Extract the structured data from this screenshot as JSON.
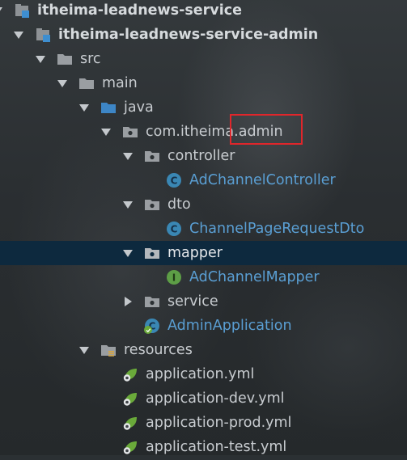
{
  "project_tree": {
    "nodes": [
      {
        "key": "r0",
        "label": "itheima-leadnews-service",
        "icon": "module-icon",
        "expand": "down",
        "style": "bold"
      },
      {
        "key": "r1",
        "label": "itheima-leadnews-service-admin",
        "icon": "module-icon",
        "expand": "down",
        "style": "bold"
      },
      {
        "key": "r2",
        "label": "src",
        "icon": "folder-icon",
        "expand": "down",
        "style": ""
      },
      {
        "key": "r3",
        "label": "main",
        "icon": "folder-icon",
        "expand": "down",
        "style": ""
      },
      {
        "key": "r4",
        "label": "java",
        "icon": "source-folder-icon",
        "expand": "down",
        "style": ""
      },
      {
        "key": "r5",
        "label": "com.itheima.admin",
        "icon": "package-icon",
        "expand": "down",
        "style": ""
      },
      {
        "key": "r6",
        "label": "controller",
        "icon": "package-icon",
        "expand": "down",
        "style": ""
      },
      {
        "key": "r7",
        "label": "AdChannelController",
        "icon": "class-icon",
        "expand": "none",
        "style": "blue"
      },
      {
        "key": "r8",
        "label": "dto",
        "icon": "package-icon",
        "expand": "down",
        "style": ""
      },
      {
        "key": "r9",
        "label": "ChannelPageRequestDto",
        "icon": "class-icon",
        "expand": "none",
        "style": "blue"
      },
      {
        "key": "r10",
        "label": "mapper",
        "icon": "package-icon",
        "expand": "down",
        "style": "",
        "selected": true
      },
      {
        "key": "r11",
        "label": "AdChannelMapper",
        "icon": "interface-icon",
        "expand": "none",
        "style": "blue"
      },
      {
        "key": "r12",
        "label": "service",
        "icon": "package-icon",
        "expand": "right",
        "style": ""
      },
      {
        "key": "r13",
        "label": "AdminApplication",
        "icon": "spring-boot-class-icon",
        "expand": "none",
        "style": "blue"
      },
      {
        "key": "r14",
        "label": "resources",
        "icon": "resources-folder-icon",
        "expand": "down",
        "style": ""
      },
      {
        "key": "r15",
        "label": "application.yml",
        "icon": "spring-yml-icon",
        "expand": "none",
        "style": ""
      },
      {
        "key": "r16",
        "label": "application-dev.yml",
        "icon": "spring-yml-icon",
        "expand": "none",
        "style": ""
      },
      {
        "key": "r17",
        "label": "application-prod.yml",
        "icon": "spring-yml-icon",
        "expand": "none",
        "style": ""
      },
      {
        "key": "r18",
        "label": "application-test.yml",
        "icon": "spring-yml-icon",
        "expand": "none",
        "style": ""
      }
    ]
  },
  "colors": {
    "background": "#2b3033",
    "selection": "#0d293e",
    "highlight_box": "#e0262b",
    "class_name_text": "#5a9fd4"
  }
}
